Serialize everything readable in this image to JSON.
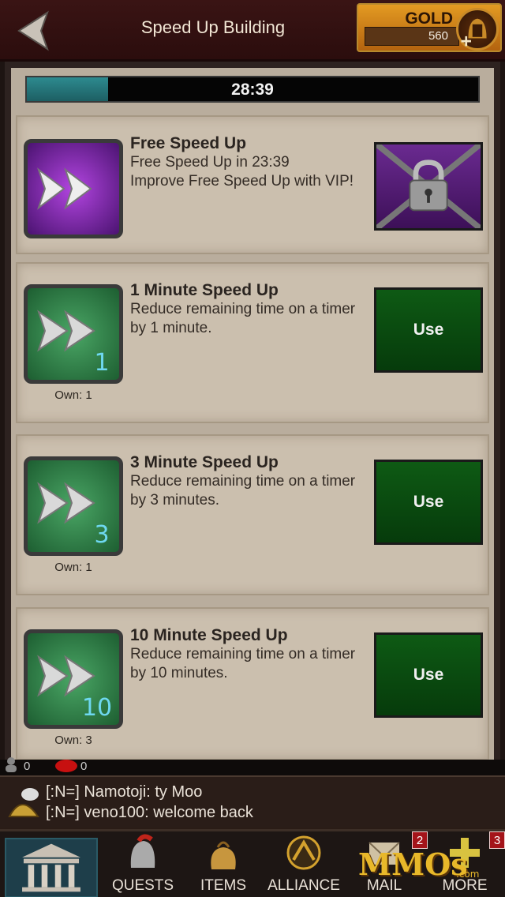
{
  "header": {
    "title": "Speed Up Building",
    "gold_label": "GOLD",
    "gold_value": "560"
  },
  "progress": {
    "time_left": "28:39",
    "fraction": 0.18
  },
  "items": [
    {
      "title": "Free Speed Up",
      "desc": "Free Speed Up in 23:39\nImprove Free Speed Up with VIP!",
      "own": "",
      "action": "locked",
      "icon_number": ""
    },
    {
      "title": "1 Minute Speed Up",
      "desc": "Reduce remaining time on a timer by 1 minute.",
      "own": "Own: 1",
      "action": "Use",
      "icon_number": "1"
    },
    {
      "title": "3 Minute Speed Up",
      "desc": "Reduce remaining time on a timer by 3 minutes.",
      "own": "Own: 1",
      "action": "Use",
      "icon_number": "3"
    },
    {
      "title": "10 Minute Speed Up",
      "desc": "Reduce remaining time on a timer by 10 minutes.",
      "own": "Own: 3",
      "action": "Use",
      "icon_number": "10"
    }
  ],
  "status": {
    "players_count": "0",
    "messages_count": "0"
  },
  "chat": {
    "line1": "[:N=] Namotoji: ty Moo",
    "line2": "[:N=] veno100: welcome back"
  },
  "nav": {
    "quests": "QUESTS",
    "items": "ITEMS",
    "alliance": "ALLIANCE",
    "mail": "MAIL",
    "more": "MORE",
    "mail_badge": "2",
    "more_badge": "3"
  },
  "watermark": {
    "text": "MMOs",
    "suffix": ".com"
  },
  "colors": {
    "progress": "#2d8a8f",
    "use_button": "#0e5a14",
    "lock_button": "#6a2a90",
    "gold": "#e39a22"
  }
}
